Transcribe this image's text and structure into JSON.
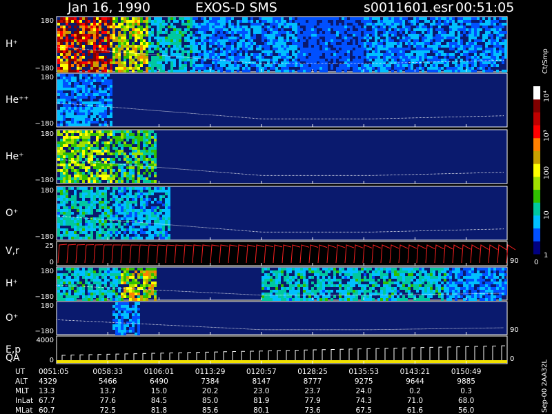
{
  "header": {
    "date": "Jan 16, 1990",
    "instrument": "EXOS-D SMS",
    "file": "s0011601.esr",
    "time": "00:51:05"
  },
  "colorbar": {
    "unit_label": "Ct/Smp",
    "ticks": [
      "10⁴",
      "10³",
      "100",
      "10",
      "1",
      "0"
    ]
  },
  "side_text": "Sep-00  2AA32L",
  "panels": [
    {
      "label": "H⁺",
      "ymax": "180",
      "ymin": "−180"
    },
    {
      "label": "He⁺⁺",
      "ymax": "180",
      "ymin": "−180"
    },
    {
      "label": "He⁺",
      "ymax": "180",
      "ymin": "−180"
    },
    {
      "label": "O⁺",
      "ymax": "180",
      "ymin": "−180"
    },
    {
      "label": "V,r",
      "ymax": "25",
      "ymin": "0",
      "right_label": "90"
    },
    {
      "label": "H⁺",
      "ymax": "180",
      "ymin": "−180"
    },
    {
      "label": "O⁺",
      "ymax": "180",
      "ymin": "−180",
      "right_label": "90"
    },
    {
      "label": "E,p",
      "label2": "QA",
      "ymax": "4000",
      "ymin": "0",
      "right_label": "0"
    }
  ],
  "ephemeris": {
    "labels": [
      "UT",
      "ALT",
      "MLT",
      "InLat",
      "MLat"
    ],
    "columns": [
      {
        "UT": "0051:05",
        "ALT": "4329",
        "MLT": "13.3",
        "InLat": "67.7",
        "MLat": "60.7"
      },
      {
        "UT": "0058:33",
        "ALT": "5466",
        "MLT": "13.7",
        "InLat": "77.6",
        "MLat": "72.5"
      },
      {
        "UT": "0106:01",
        "ALT": "6490",
        "MLT": "15.0",
        "InLat": "84.5",
        "MLat": "81.8"
      },
      {
        "UT": "0113:29",
        "ALT": "7384",
        "MLT": "20.2",
        "InLat": "85.0",
        "MLat": "85.6"
      },
      {
        "UT": "0120:57",
        "ALT": "8147",
        "MLT": "23.0",
        "InLat": "81.9",
        "MLat": "80.1"
      },
      {
        "UT": "0128:25",
        "ALT": "8777",
        "MLT": "23.7",
        "InLat": "77.9",
        "MLat": "73.6"
      },
      {
        "UT": "0135:53",
        "ALT": "9275",
        "MLT": "24.0",
        "InLat": "74.3",
        "MLat": "67.5"
      },
      {
        "UT": "0143:21",
        "ALT": "9644",
        "MLT": "0.2",
        "InLat": "71.0",
        "MLat": "61.6"
      },
      {
        "UT": "0150:49",
        "ALT": "9885",
        "MLT": "0.3",
        "InLat": "68.0",
        "MLat": "56.0"
      }
    ]
  },
  "chart_data": {
    "type": "heatmap",
    "x": [
      "0051:05",
      "0058:33",
      "0106:01",
      "0113:29",
      "0120:57",
      "0128:25",
      "0135:53",
      "0143:21",
      "0150:49"
    ],
    "ylim": [
      -180,
      180
    ],
    "colorscale": [
      "#000080",
      "#0050ff",
      "#00c0ff",
      "#00c8a0",
      "#30c000",
      "#a0e000",
      "#ffff00",
      "#c8a000",
      "#ff8000",
      "#ff0000",
      "#c00000",
      "#800000",
      "#ffffff"
    ],
    "colors": {
      "background": "#000000",
      "panel_fill": "#0a1a6e",
      "vr_line": "#ff2020",
      "trace": "#ffffff",
      "qa_bar": "#f0e000"
    }
  }
}
